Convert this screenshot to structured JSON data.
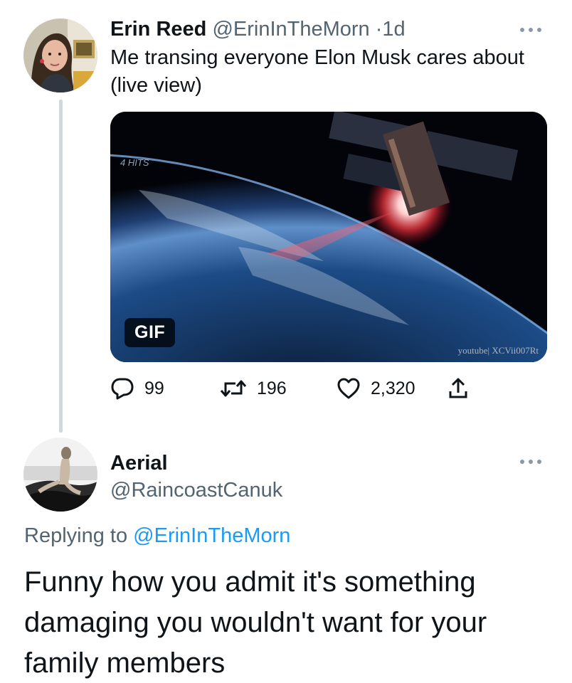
{
  "tweet1": {
    "name": "Erin Reed",
    "handle": "@ErinInTheMorn",
    "separator": "·",
    "time": "1d",
    "text": "Me transing everyone Elon Musk cares about (live view)",
    "media": {
      "badge": "GIF",
      "overlay_text": "4 HITS",
      "watermark": "youtube| XCVii007Rt"
    },
    "actions": {
      "reply_count": "99",
      "retweet_count": "196",
      "like_count": "2,320"
    },
    "more_icon": "ellipsis-icon"
  },
  "tweet2": {
    "name": "Aerial",
    "handle": "@RaincoastCanuk",
    "replying_prefix": "Replying to",
    "replying_to": "@ErinInTheMorn",
    "text": "Funny how you admit it's something damaging you wouldn't want for your family members",
    "more_icon": "ellipsis-icon"
  },
  "colors": {
    "text_primary": "#0f1419",
    "text_secondary": "#536471",
    "link": "#1d9bf0",
    "thread_line": "#cfd9de"
  }
}
